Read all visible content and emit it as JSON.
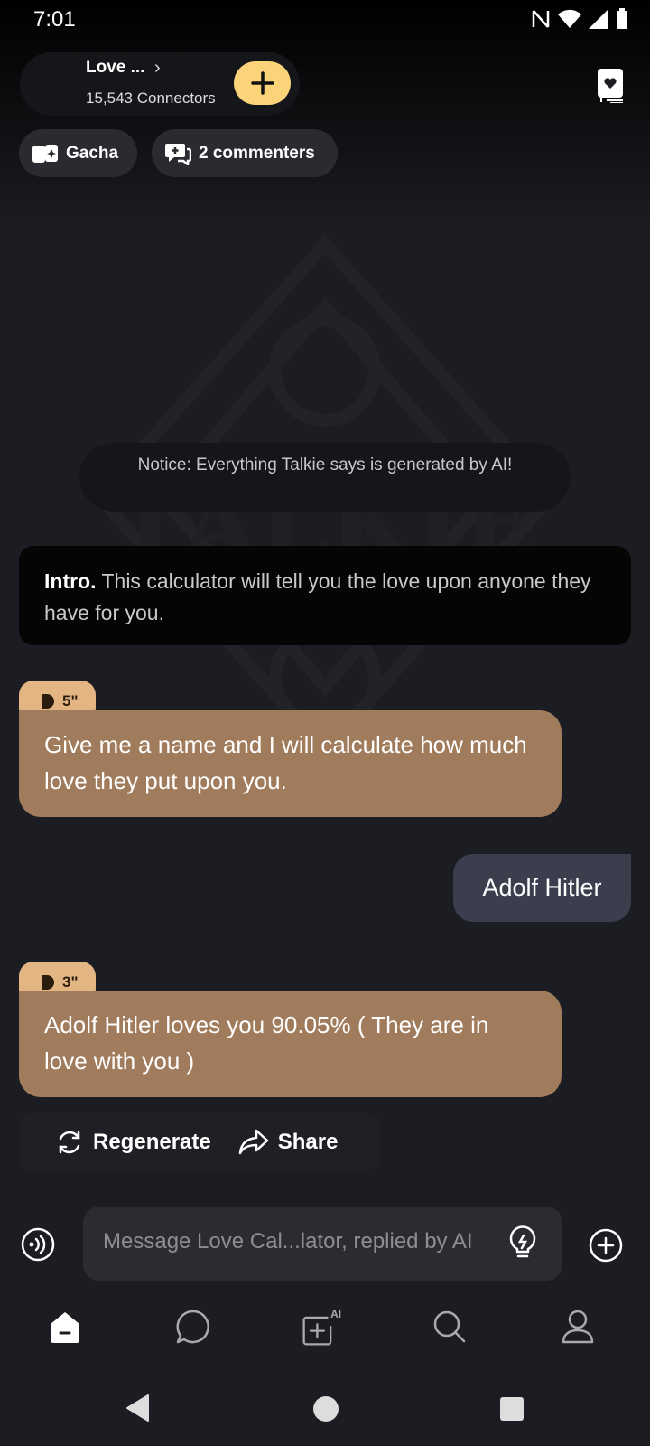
{
  "status": {
    "time": "7:01"
  },
  "header": {
    "character_name": "Love ...",
    "connectors": "15,543 Connectors"
  },
  "chips": {
    "gacha": "Gacha",
    "commenters": "2 commenters"
  },
  "notice": "Notice: Everything Talkie says is generated by AI!",
  "intro": {
    "label": "Intro.",
    "text": " This calculator will tell you the love upon anyone they have for you."
  },
  "messages": [
    {
      "role": "bot",
      "duration": "5\"",
      "text": "Give me a name and I will calculate how much love they put upon you."
    },
    {
      "role": "user",
      "text": "Adolf Hitler"
    },
    {
      "role": "bot",
      "duration": "3\"",
      "text": "Adolf Hitler loves you 90.05% ( They are in love with you )"
    }
  ],
  "actions": {
    "regenerate": "Regenerate",
    "share": "Share"
  },
  "composer": {
    "placeholder": "Message Love Cal...lator, replied by AI"
  },
  "tabs": [
    "home-icon",
    "chat-icon",
    "create-ai-icon",
    "search-icon",
    "profile-icon"
  ],
  "colors": {
    "accent": "#fbd47a",
    "bot_bubble": "#a07b5c",
    "user_bubble": "#3a3e4d"
  }
}
